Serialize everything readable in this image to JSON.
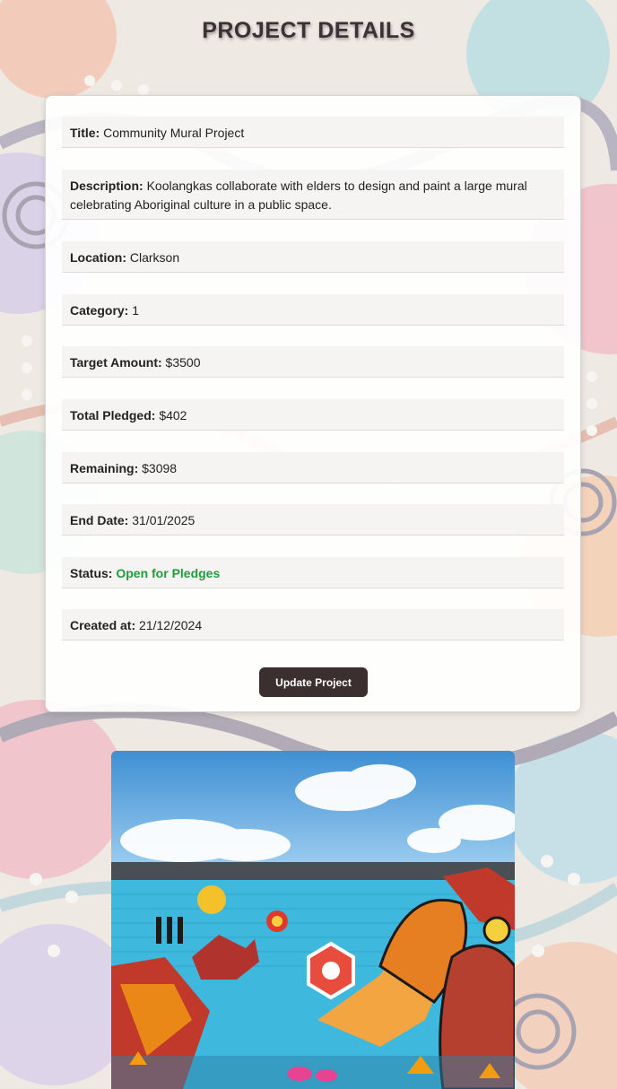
{
  "page": {
    "title": "PROJECT DETAILS"
  },
  "project": {
    "title": {
      "label": "Title:",
      "value": "Community Mural Project"
    },
    "description": {
      "label": "Description:",
      "value": "Koolangkas collaborate with elders to design and paint a large mural celebrating Aboriginal culture in a public space."
    },
    "location": {
      "label": "Location:",
      "value": "Clarkson"
    },
    "category": {
      "label": "Category:",
      "value": "1"
    },
    "target_amount": {
      "label": "Target Amount:",
      "value": "$3500"
    },
    "total_pledged": {
      "label": "Total Pledged:",
      "value": "$402"
    },
    "remaining": {
      "label": "Remaining:",
      "value": "$3098"
    },
    "end_date": {
      "label": "End Date:",
      "value": "31/01/2025"
    },
    "status": {
      "label": "Status:",
      "value": "Open for Pledges",
      "color": "#1f9d3a"
    },
    "created_at": {
      "label": "Created at:",
      "value": "21/12/2024"
    }
  },
  "actions": {
    "update_label": "Update Project"
  },
  "colors": {
    "button_bg": "#3b2f30",
    "card_bg": "#ffffff",
    "row_bg": "#f5f4f3"
  }
}
